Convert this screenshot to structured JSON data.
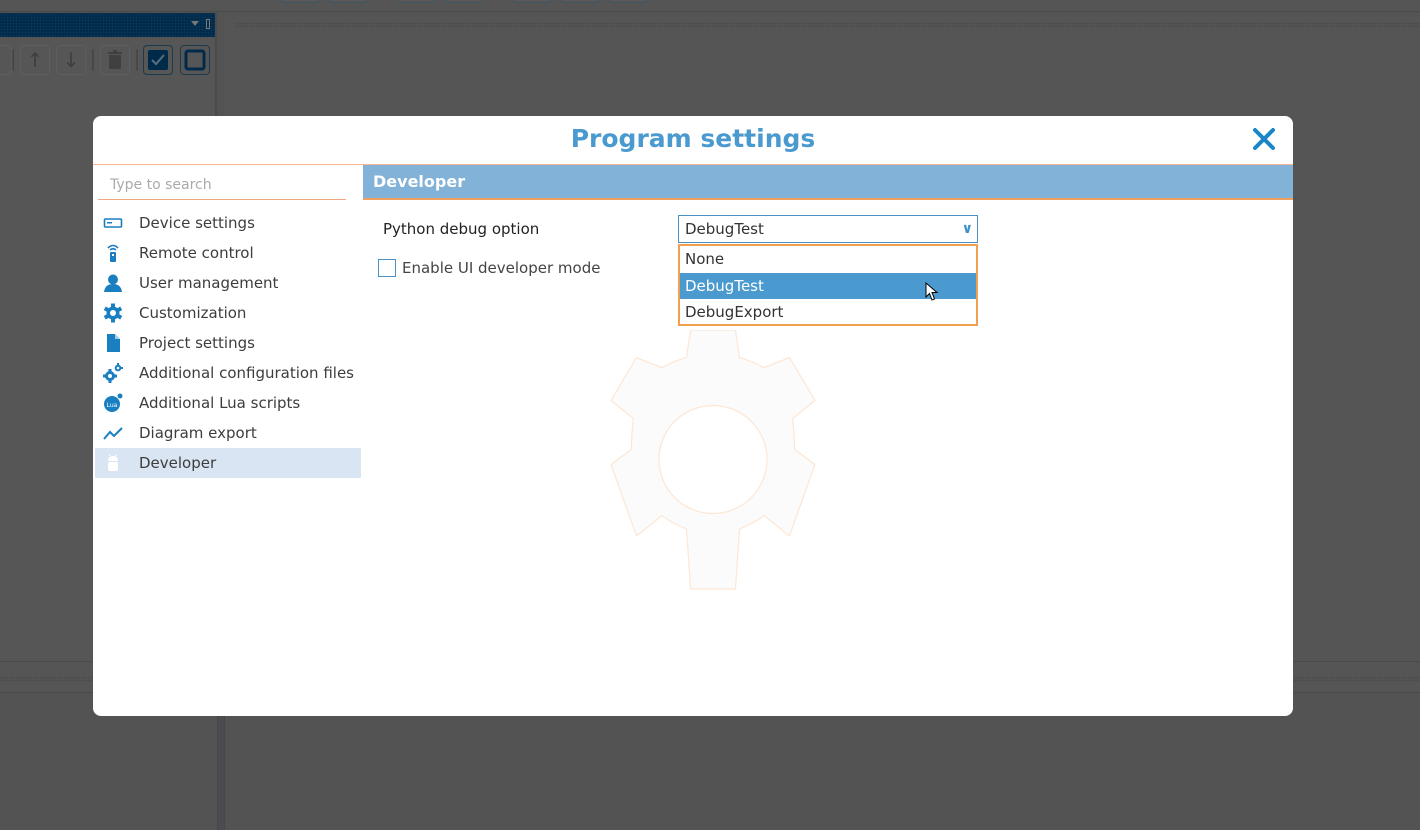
{
  "dialog": {
    "title": "Program settings",
    "close_icon": "close-icon"
  },
  "sidebar": {
    "search_placeholder": "Type to search",
    "search_value": "",
    "items": [
      {
        "label": "Device settings",
        "icon": "device-icon",
        "selected": false
      },
      {
        "label": "Remote control",
        "icon": "remote-icon",
        "selected": false
      },
      {
        "label": "User management",
        "icon": "user-icon",
        "selected": false
      },
      {
        "label": "Customization",
        "icon": "gear-icon",
        "selected": false
      },
      {
        "label": "Project settings",
        "icon": "file-icon",
        "selected": false
      },
      {
        "label": "Additional configuration files",
        "icon": "gears-icon",
        "selected": false
      },
      {
        "label": "Additional Lua scripts",
        "icon": "lua-icon",
        "selected": false
      },
      {
        "label": "Diagram export",
        "icon": "chart-line-icon",
        "selected": false
      },
      {
        "label": "Developer",
        "icon": "android-icon",
        "selected": true
      }
    ]
  },
  "content": {
    "section_title": "Developer",
    "python_debug": {
      "label": "Python debug option",
      "value": "DebugTest",
      "options": [
        "None",
        "DebugTest",
        "DebugExport"
      ],
      "highlighted": "DebugTest"
    },
    "ui_dev_mode": {
      "label": "Enable UI developer mode",
      "checked": false
    }
  },
  "colors": {
    "accent": "#4a9ad0",
    "section_header": "#82b2d8",
    "orange_rule": "#f0a060",
    "selected_nav": "#dae5f4"
  }
}
